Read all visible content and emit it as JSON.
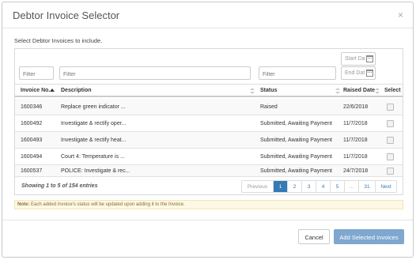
{
  "modal": {
    "title": "Debtor Invoice Selector",
    "close_glyph": "×",
    "instruction": "Select Debtor Invoices to include."
  },
  "filters": {
    "invoice_placeholder": "Filter",
    "description_placeholder": "Filter",
    "status_placeholder": "Filter",
    "start_date_placeholder": "Start Da",
    "end_date_placeholder": "End Dat"
  },
  "columns": {
    "invoice_no": "Invoice No.",
    "description": "Description",
    "status": "Status",
    "raised_date": "Raised Date",
    "select": "Select"
  },
  "rows": [
    {
      "invoice_no": "1600346",
      "description": "Replace green indicator ...",
      "status": "Raised",
      "raised_date": "22/6/2018"
    },
    {
      "invoice_no": "1600492",
      "description": "Investigate & rectify oper...",
      "status": "Submitted, Awaiting Payment",
      "raised_date": "11/7/2018"
    },
    {
      "invoice_no": "1600493",
      "description": "Investigate & rectify heat...",
      "status": "Submitted, Awaiting Payment",
      "raised_date": "11/7/2018"
    },
    {
      "invoice_no": "1600494",
      "description": "Court 4: Temperature is ...",
      "status": "Submitted, Awaiting Payment",
      "raised_date": "11/7/2018"
    },
    {
      "invoice_no": "1600537",
      "description": "POLICE: Investigate & rec...",
      "status": "Submitted, Awaiting Payment",
      "raised_date": "24/7/2018"
    }
  ],
  "showing_text": "Showing 1 to 5 of 154 entries",
  "pagination": {
    "previous": "Previous",
    "pages": [
      "1",
      "2",
      "3",
      "4",
      "5",
      "...",
      "31"
    ],
    "next": "Next",
    "active_page": "1"
  },
  "note": {
    "label": "Note:",
    "text": " Each added Invoice's status will be updated upon adding it to the Invoice."
  },
  "buttons": {
    "cancel": "Cancel",
    "add": "Add Selected Invoices"
  },
  "colors": {
    "primary": "#337ab7",
    "add_button": "#7fa7cf",
    "note_bg": "#fcf8e3"
  }
}
